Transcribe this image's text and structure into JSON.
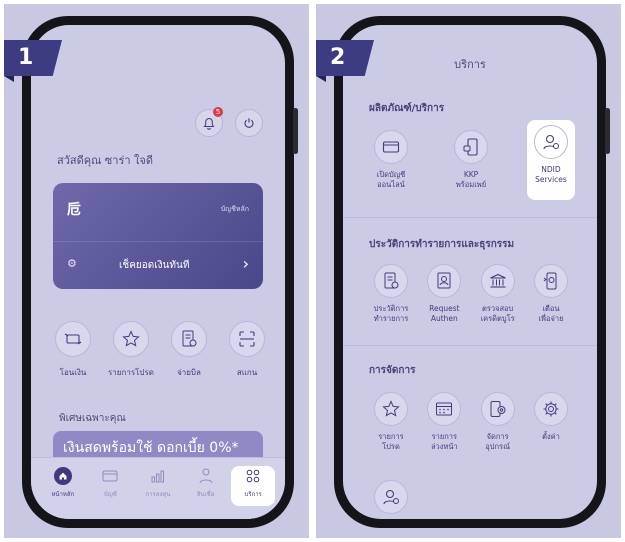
{
  "panel1": {
    "step": "1",
    "greeting": "สวัสดีคุณ ซาร่า ใจดี",
    "notification_count": "5",
    "card": {
      "logo": "卮",
      "account_type": "บัญชีหลัก",
      "check_balance": "เช็คยอดเงินทันที"
    },
    "quick_actions": [
      {
        "label": "โอนเงิน",
        "icon": "transfer-icon"
      },
      {
        "label": "รายการโปรด",
        "icon": "star-icon"
      },
      {
        "label": "จ่ายบิล",
        "icon": "bill-icon"
      },
      {
        "label": "สแกน",
        "icon": "scan-icon"
      }
    ],
    "special_title": "พิเศษเฉพาะคุณ",
    "promo_text": "เงินสดพร้อมใช้ ดอกเบี้ย 0%*",
    "nav": [
      {
        "label": "หน้าหลัก",
        "icon": "home-icon"
      },
      {
        "label": "บัญชี",
        "icon": "wallet-icon"
      },
      {
        "label": "การลงทุน",
        "icon": "invest-icon"
      },
      {
        "label": "สินเชื่อ",
        "icon": "loan-icon"
      },
      {
        "label": "บริการ",
        "icon": "services-icon"
      }
    ]
  },
  "panel2": {
    "step": "2",
    "title": "บริการ",
    "sections": [
      {
        "title": "ผลิตภัณฑ์/บริการ",
        "items": [
          {
            "label": "เปิดบัญชี\nออนไลน์",
            "icon": "card-icon"
          },
          {
            "label": "KKP\nพร้อมเพย์",
            "icon": "phone-icon"
          },
          {
            "label": "NDID\nServices",
            "icon": "ndid-icon"
          }
        ]
      },
      {
        "title": "ประวัติการทำรายการและธุรกรรม",
        "items": [
          {
            "label": "ประวัติการ\nทำรายการ",
            "icon": "history-icon"
          },
          {
            "label": "Request\nAuthen",
            "icon": "request-authen-icon"
          },
          {
            "label": "ตรวจสอบ\nเครดิตบูโร",
            "icon": "bank-icon"
          },
          {
            "label": "เตือน\nเพื่อจ่าย",
            "icon": "reminder-icon"
          }
        ]
      },
      {
        "title": "การจัดการ",
        "items": [
          {
            "label": "รายการ\nโปรด",
            "icon": "star-icon"
          },
          {
            "label": "รายการ\nล่วงหน้า",
            "icon": "calendar-icon"
          },
          {
            "label": "จัดการ\nอุปกรณ์",
            "icon": "device-icon"
          },
          {
            "label": "ตั้งค่า",
            "icon": "gear-icon"
          }
        ]
      }
    ]
  },
  "colors": {
    "background": "#c9c8e3",
    "accent": "#3d3c83",
    "card": "#5a57a0"
  }
}
